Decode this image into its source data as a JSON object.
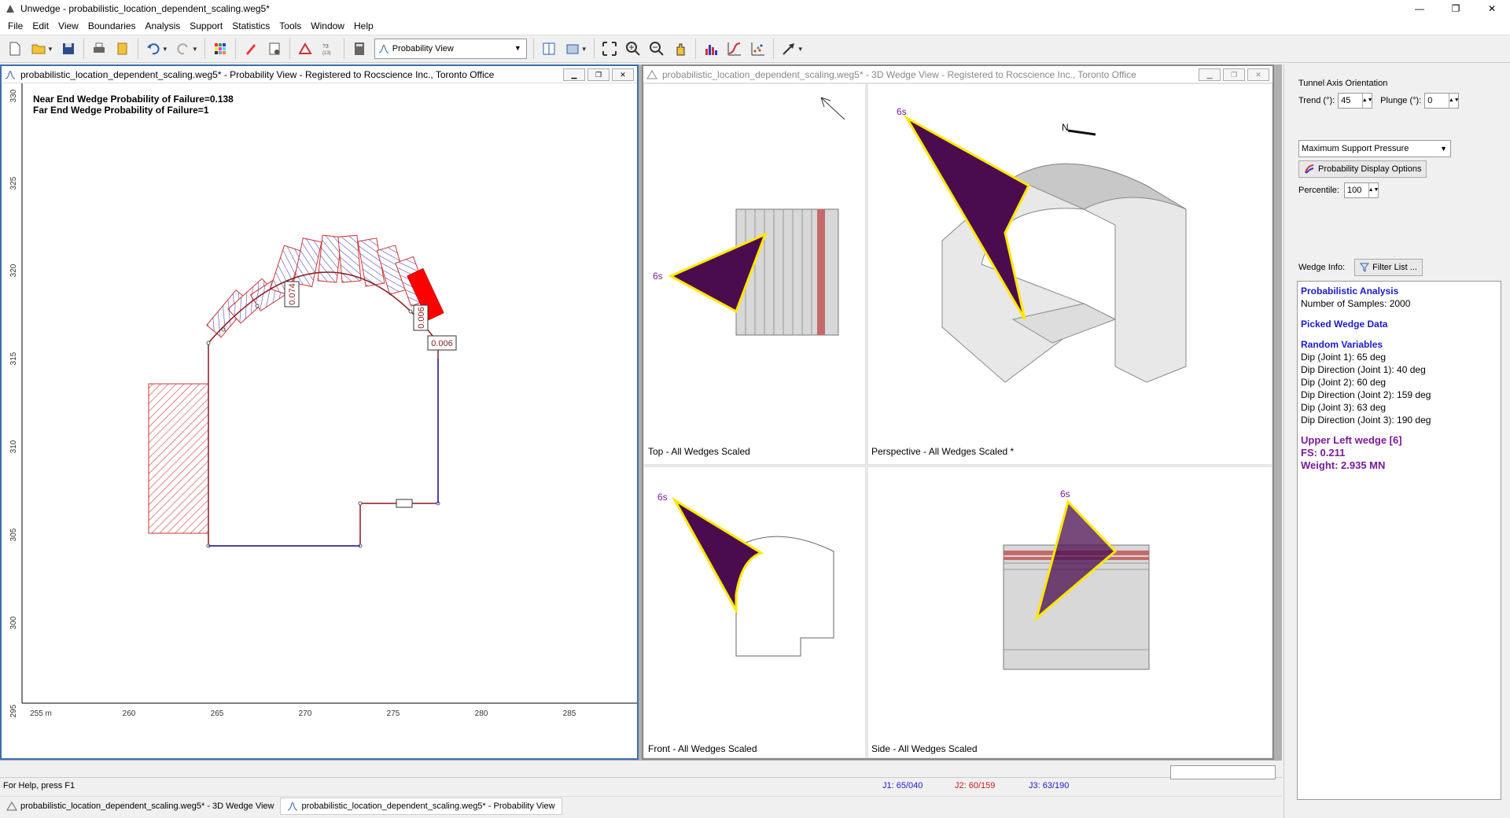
{
  "window": {
    "title": "Unwedge - probabilistic_location_dependent_scaling.weg5*",
    "min": "—",
    "max": "❐",
    "close": "✕"
  },
  "menu": [
    "File",
    "Edit",
    "View",
    "Boundaries",
    "Analysis",
    "Support",
    "Statistics",
    "Tools",
    "Window",
    "Help"
  ],
  "toolbar": {
    "view_select": "Probability View"
  },
  "prob_window": {
    "title": "probabilistic_location_dependent_scaling.weg5* - Probability View - Registered to Rocscience Inc., Toronto Office",
    "near_end": "Near End Wedge Probability of Failure=0.138",
    "far_end": "Far End Wedge Probability of Failure=1",
    "y_ticks": [
      "330",
      "325",
      "320",
      "315",
      "310",
      "305",
      "300",
      "295"
    ],
    "x_ticks": [
      "255 m",
      "260",
      "265",
      "270",
      "275",
      "280",
      "285"
    ],
    "labels": [
      "0.074",
      "0.006",
      "0.006"
    ]
  },
  "wedge_window": {
    "title": "probabilistic_location_dependent_scaling.weg5* - 3D Wedge View - Registered to Rocscience Inc., Toronto Office",
    "views": {
      "top": "Top - All Wedges Scaled",
      "perspective": "Perspective - All Wedges Scaled *",
      "front": "Front - All Wedges Scaled",
      "side": "Side - All Wedges Scaled"
    },
    "wedge_label": "6s",
    "north_label": "N"
  },
  "panel": {
    "orientation_title": "Tunnel Axis Orientation",
    "trend_label": "Trend (°):",
    "trend_value": "45",
    "plunge_label": "Plunge (°):",
    "plunge_value": "0",
    "support_select": "Maximum Support Pressure",
    "prob_options_btn": "Probability Display Options",
    "percentile_label": "Percentile:",
    "percentile_value": "100",
    "wedge_info_label": "Wedge Info:",
    "filter_btn": "Filter List ..."
  },
  "info": {
    "prob_analysis": "Probabilistic Analysis",
    "samples": "Number of Samples: 2000",
    "picked": "Picked Wedge Data",
    "random_vars": "Random Variables",
    "vars": [
      "Dip (Joint 1): 65 deg",
      "Dip Direction (Joint 1): 40 deg",
      "Dip (Joint 2): 60 deg",
      "Dip Direction (Joint 2): 159 deg",
      "Dip (Joint 3): 63 deg",
      "Dip Direction (Joint 3): 190 deg"
    ],
    "wedge_name": "Upper Left wedge [6]",
    "fs": "FS: 0.211",
    "weight": "Weight: 2.935 MN"
  },
  "status": {
    "help": "For Help, press F1",
    "j1": "J1: 65/040",
    "j2": "J2: 60/159",
    "j3": "J3: 63/190",
    "j1_color": "#1a1acc",
    "j2_color": "#cc1a1a",
    "j3_color": "#1a1acc"
  },
  "tasks": [
    "probabilistic_location_dependent_scaling.weg5* - 3D Wedge View",
    "probabilistic_location_dependent_scaling.weg5* - Probability View"
  ]
}
